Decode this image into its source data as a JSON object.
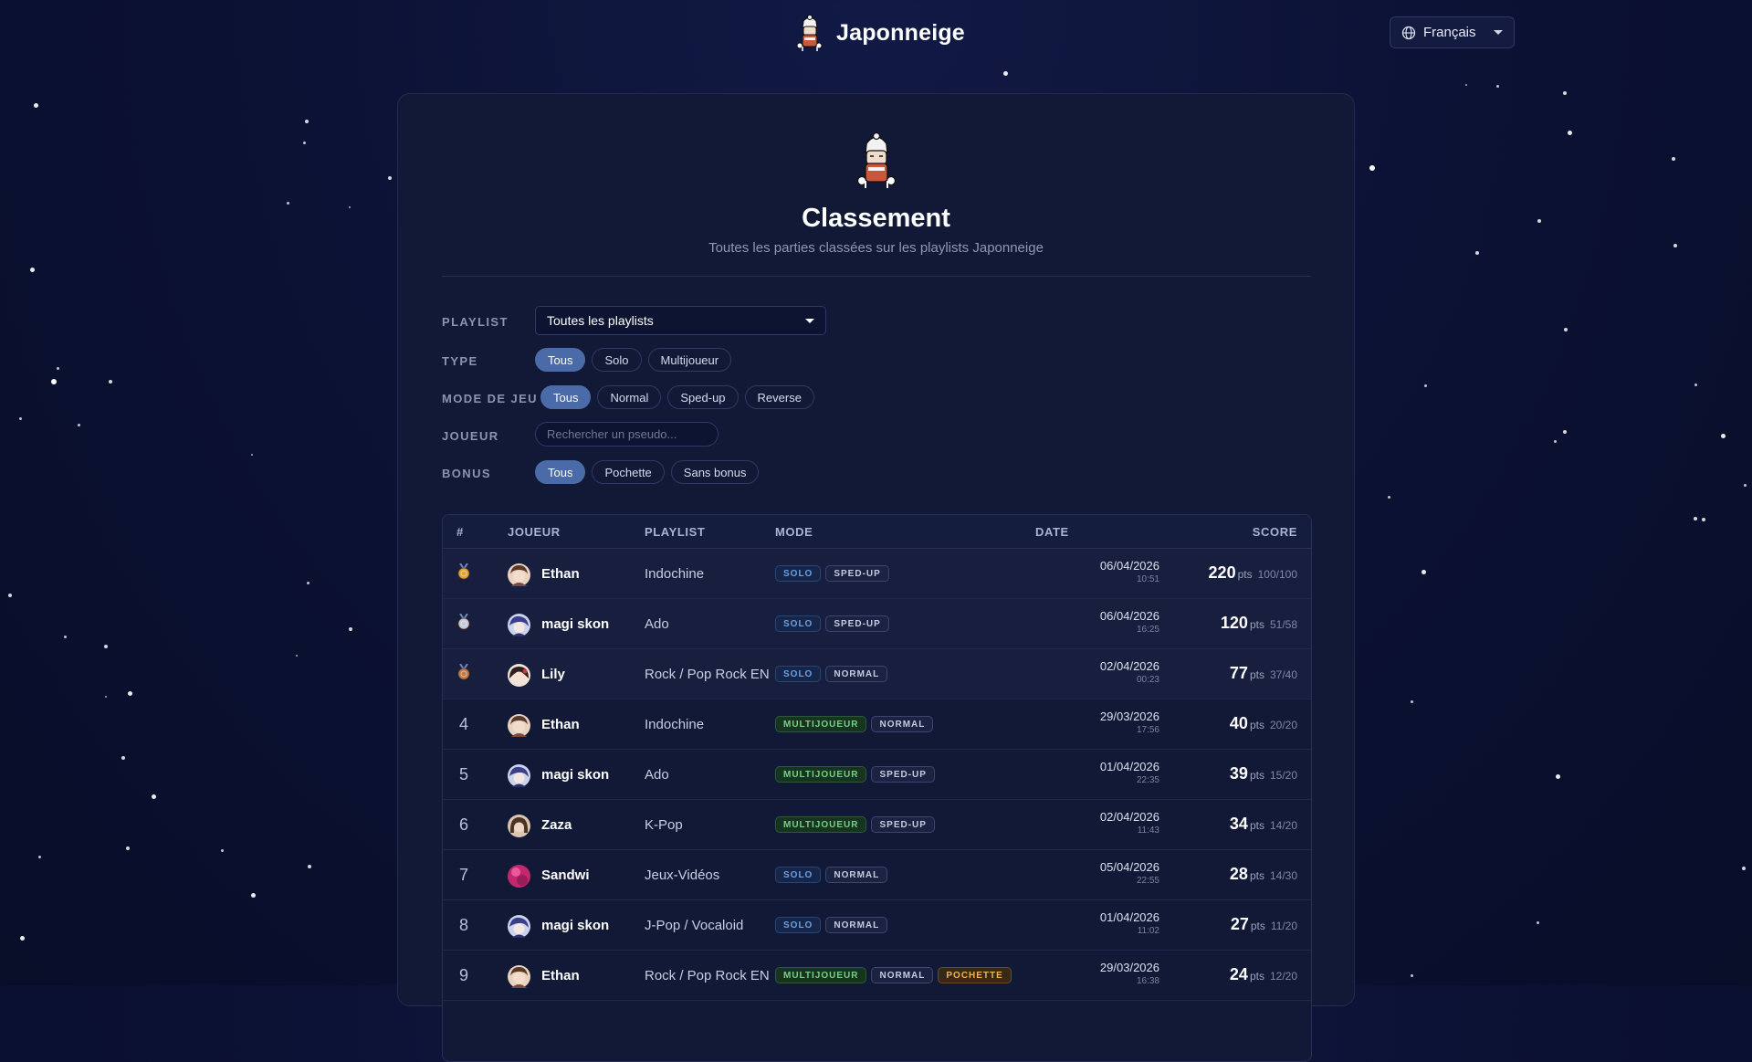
{
  "header": {
    "brand": "Japonneige",
    "language": "Français"
  },
  "page": {
    "title": "Classement",
    "subtitle": "Toutes les parties classées sur les playlists Japonneige"
  },
  "filters": {
    "playlist": {
      "label": "PLAYLIST",
      "value": "Toutes les playlists"
    },
    "type": {
      "label": "TYPE",
      "options": [
        "Tous",
        "Solo",
        "Multijoueur"
      ],
      "selected": "Tous"
    },
    "game_mode": {
      "label": "MODE DE JEU",
      "options": [
        "Tous",
        "Normal",
        "Sped-up",
        "Reverse"
      ],
      "selected": "Tous"
    },
    "player": {
      "label": "JOUEUR",
      "placeholder": "Rechercher un pseudo..."
    },
    "bonus": {
      "label": "BONUS",
      "options": [
        "Tous",
        "Pochette",
        "Sans bonus"
      ],
      "selected": "Tous"
    }
  },
  "table": {
    "headers": {
      "rank": "#",
      "player": "JOUEUR",
      "playlist": "PLAYLIST",
      "mode": "MODE",
      "date": "DATE",
      "score": "SCORE"
    },
    "pts_unit": "pts",
    "rows": [
      {
        "rank": "",
        "medal": "gold",
        "player": "Ethan",
        "avatar": "ethan",
        "playlist": "Indochine",
        "badges": [
          "SOLO",
          "SPED-UP"
        ],
        "date": "06/04/2026",
        "time": "10:51",
        "score": "220",
        "fraction": "100/100"
      },
      {
        "rank": "",
        "medal": "silver",
        "player": "magi skon",
        "avatar": "magi",
        "playlist": "Ado",
        "badges": [
          "SOLO",
          "SPED-UP"
        ],
        "date": "06/04/2026",
        "time": "16:25",
        "score": "120",
        "fraction": "51/58"
      },
      {
        "rank": "",
        "medal": "bronze",
        "player": "Lily",
        "avatar": "lily",
        "playlist": "Rock / Pop Rock EN",
        "badges": [
          "SOLO",
          "NORMAL"
        ],
        "date": "02/04/2026",
        "time": "00:23",
        "score": "77",
        "fraction": "37/40"
      },
      {
        "rank": "4",
        "medal": "",
        "player": "Ethan",
        "avatar": "ethan",
        "playlist": "Indochine",
        "badges": [
          "MULTIJOUEUR",
          "NORMAL"
        ],
        "date": "29/03/2026",
        "time": "17:56",
        "score": "40",
        "fraction": "20/20"
      },
      {
        "rank": "5",
        "medal": "",
        "player": "magi skon",
        "avatar": "magi",
        "playlist": "Ado",
        "badges": [
          "MULTIJOUEUR",
          "SPED-UP"
        ],
        "date": "01/04/2026",
        "time": "22:35",
        "score": "39",
        "fraction": "15/20"
      },
      {
        "rank": "6",
        "medal": "",
        "player": "Zaza",
        "avatar": "zaza",
        "playlist": "K-Pop",
        "badges": [
          "MULTIJOUEUR",
          "SPED-UP"
        ],
        "date": "02/04/2026",
        "time": "11:43",
        "score": "34",
        "fraction": "14/20"
      },
      {
        "rank": "7",
        "medal": "",
        "player": "Sandwi",
        "avatar": "sandwi",
        "playlist": "Jeux-Vidéos",
        "badges": [
          "SOLO",
          "NORMAL"
        ],
        "date": "05/04/2026",
        "time": "22:55",
        "score": "28",
        "fraction": "14/30"
      },
      {
        "rank": "8",
        "medal": "",
        "player": "magi skon",
        "avatar": "magi",
        "playlist": "J-Pop / Vocaloid",
        "badges": [
          "SOLO",
          "NORMAL"
        ],
        "date": "01/04/2026",
        "time": "11:02",
        "score": "27",
        "fraction": "11/20"
      },
      {
        "rank": "9",
        "medal": "",
        "player": "Ethan",
        "avatar": "ethan",
        "playlist": "Rock / Pop Rock EN",
        "badges": [
          "MULTIJOUEUR",
          "NORMAL",
          "POCHETTE"
        ],
        "date": "29/03/2026",
        "time": "16:38",
        "score": "24",
        "fraction": "12/20"
      }
    ]
  },
  "colors": {
    "background": "#0c1235",
    "card": "#111936",
    "accent": "#4b6ba8",
    "solo": "#6ca0e0",
    "multi": "#76cf86",
    "pochette": "#f0b157",
    "gold": "#e0a33c",
    "silver": "#c3c8d6",
    "bronze": "#c07a4a"
  }
}
